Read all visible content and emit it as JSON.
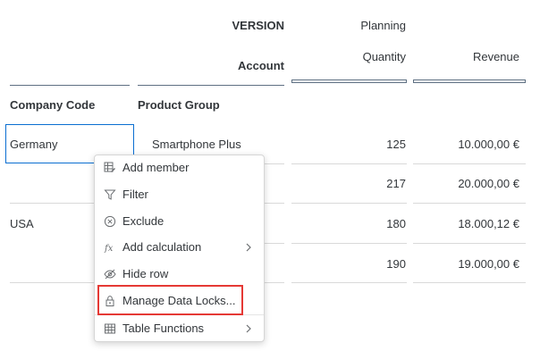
{
  "header": {
    "version_label": "VERSION",
    "version_value": "Planning",
    "account_label": "Account",
    "measure_quantity": "Quantity",
    "measure_revenue": "Revenue"
  },
  "columns": {
    "company_code": "Company Code",
    "product_group": "Product Group"
  },
  "rows": [
    {
      "company": "Germany",
      "product": "Smartphone Plus",
      "quantity": "125",
      "revenue": "10.000,00 €"
    },
    {
      "company": "",
      "product": "",
      "quantity": "217",
      "revenue": "20.000,00 €"
    },
    {
      "company": "USA",
      "product": "",
      "quantity": "180",
      "revenue": "18.000,12 €"
    },
    {
      "company": "",
      "product": "",
      "quantity": "190",
      "revenue": "19.000,00 €"
    }
  ],
  "context_menu": {
    "items": [
      {
        "label": "Add member",
        "icon": "add-member-icon"
      },
      {
        "label": "Filter",
        "icon": "filter-icon"
      },
      {
        "label": "Exclude",
        "icon": "exclude-icon"
      },
      {
        "label": "Add calculation",
        "icon": "function-icon",
        "submenu": true
      },
      {
        "label": "Hide row",
        "icon": "hide-icon"
      },
      {
        "label": "Manage Data Locks...",
        "icon": "lock-icon",
        "highlighted": true
      },
      {
        "label": "Table Functions",
        "icon": "table-icon",
        "submenu": true
      }
    ]
  },
  "colors": {
    "header_line": "#5f7083",
    "selection_border": "#0a6ed1",
    "highlight": "#e53935",
    "grid_line": "#d9d9d9"
  }
}
